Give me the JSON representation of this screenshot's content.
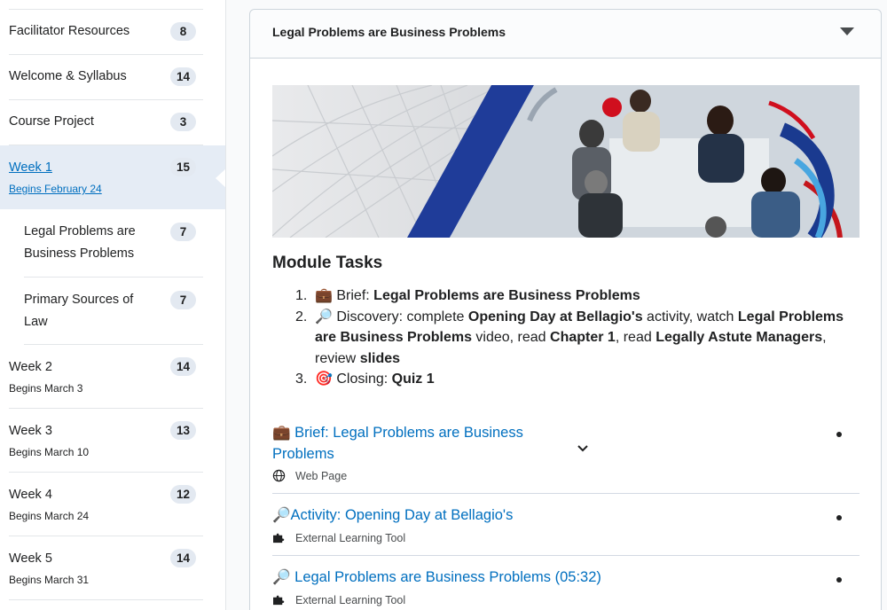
{
  "sidebar": {
    "items": [
      {
        "label": "Facilitator Resources",
        "count": "8"
      },
      {
        "label": "Welcome & Syllabus",
        "count": "14"
      },
      {
        "label": "Course Project",
        "count": "3"
      },
      {
        "label": "Week 1",
        "sub": "Begins February 24",
        "count": "15"
      },
      {
        "label": "Legal Problems are",
        "label2": "Business Problems",
        "count": "7"
      },
      {
        "label": "Primary Sources of",
        "label2": "Law",
        "count": "7"
      },
      {
        "label": "Week 2",
        "sub": "Begins March 3",
        "count": "14"
      },
      {
        "label": "Week 3",
        "sub": "Begins March 10",
        "count": "13"
      },
      {
        "label": "Week 4",
        "sub": "Begins March 24",
        "count": "12"
      },
      {
        "label": "Week 5",
        "sub": "Begins March 31",
        "count": "14"
      }
    ]
  },
  "panel": {
    "title": "Legal Problems are Business Problems",
    "module_tasks_heading": "Module Tasks",
    "tasks": {
      "t1": {
        "num": "1.",
        "emoji": "💼",
        "prefix": "Brief: ",
        "b1": "Legal Problems are Business Problems"
      },
      "t2": {
        "num": "2.",
        "emoji": "🔎",
        "prefix": "Discovery: complete ",
        "b1": "Opening Day at Bellagio's",
        "m1": " activity, watch ",
        "b2": "Legal Problems are Business Problems",
        "m2": " video, read ",
        "b3": "Chapter 1",
        "m3": ", read ",
        "b4": "Legally Astute Managers",
        "m4": ", review ",
        "b5": "slides"
      },
      "t3": {
        "num": "3.",
        "emoji": "🎯",
        "prefix": "Closing: ",
        "b1": "Quiz 1"
      }
    },
    "activities": [
      {
        "emoji": "💼",
        "title": "Brief: Legal Problems are Business",
        "title2": "Problems",
        "type": "Web Page",
        "type_icon": "globe-icon"
      },
      {
        "emoji": "🔎",
        "title": "Activity: Opening Day at Bellagio's",
        "type": "External Learning Tool",
        "type_icon": "puzzle-icon"
      },
      {
        "emoji": "🔎",
        "title": "Legal Problems are Business Problems (05:32)",
        "type": "External Learning Tool",
        "type_icon": "puzzle-icon"
      }
    ]
  },
  "colors": {
    "link": "#006fbf",
    "active_bg": "#e5ecf5",
    "badge_bg": "#e3e9f1"
  }
}
